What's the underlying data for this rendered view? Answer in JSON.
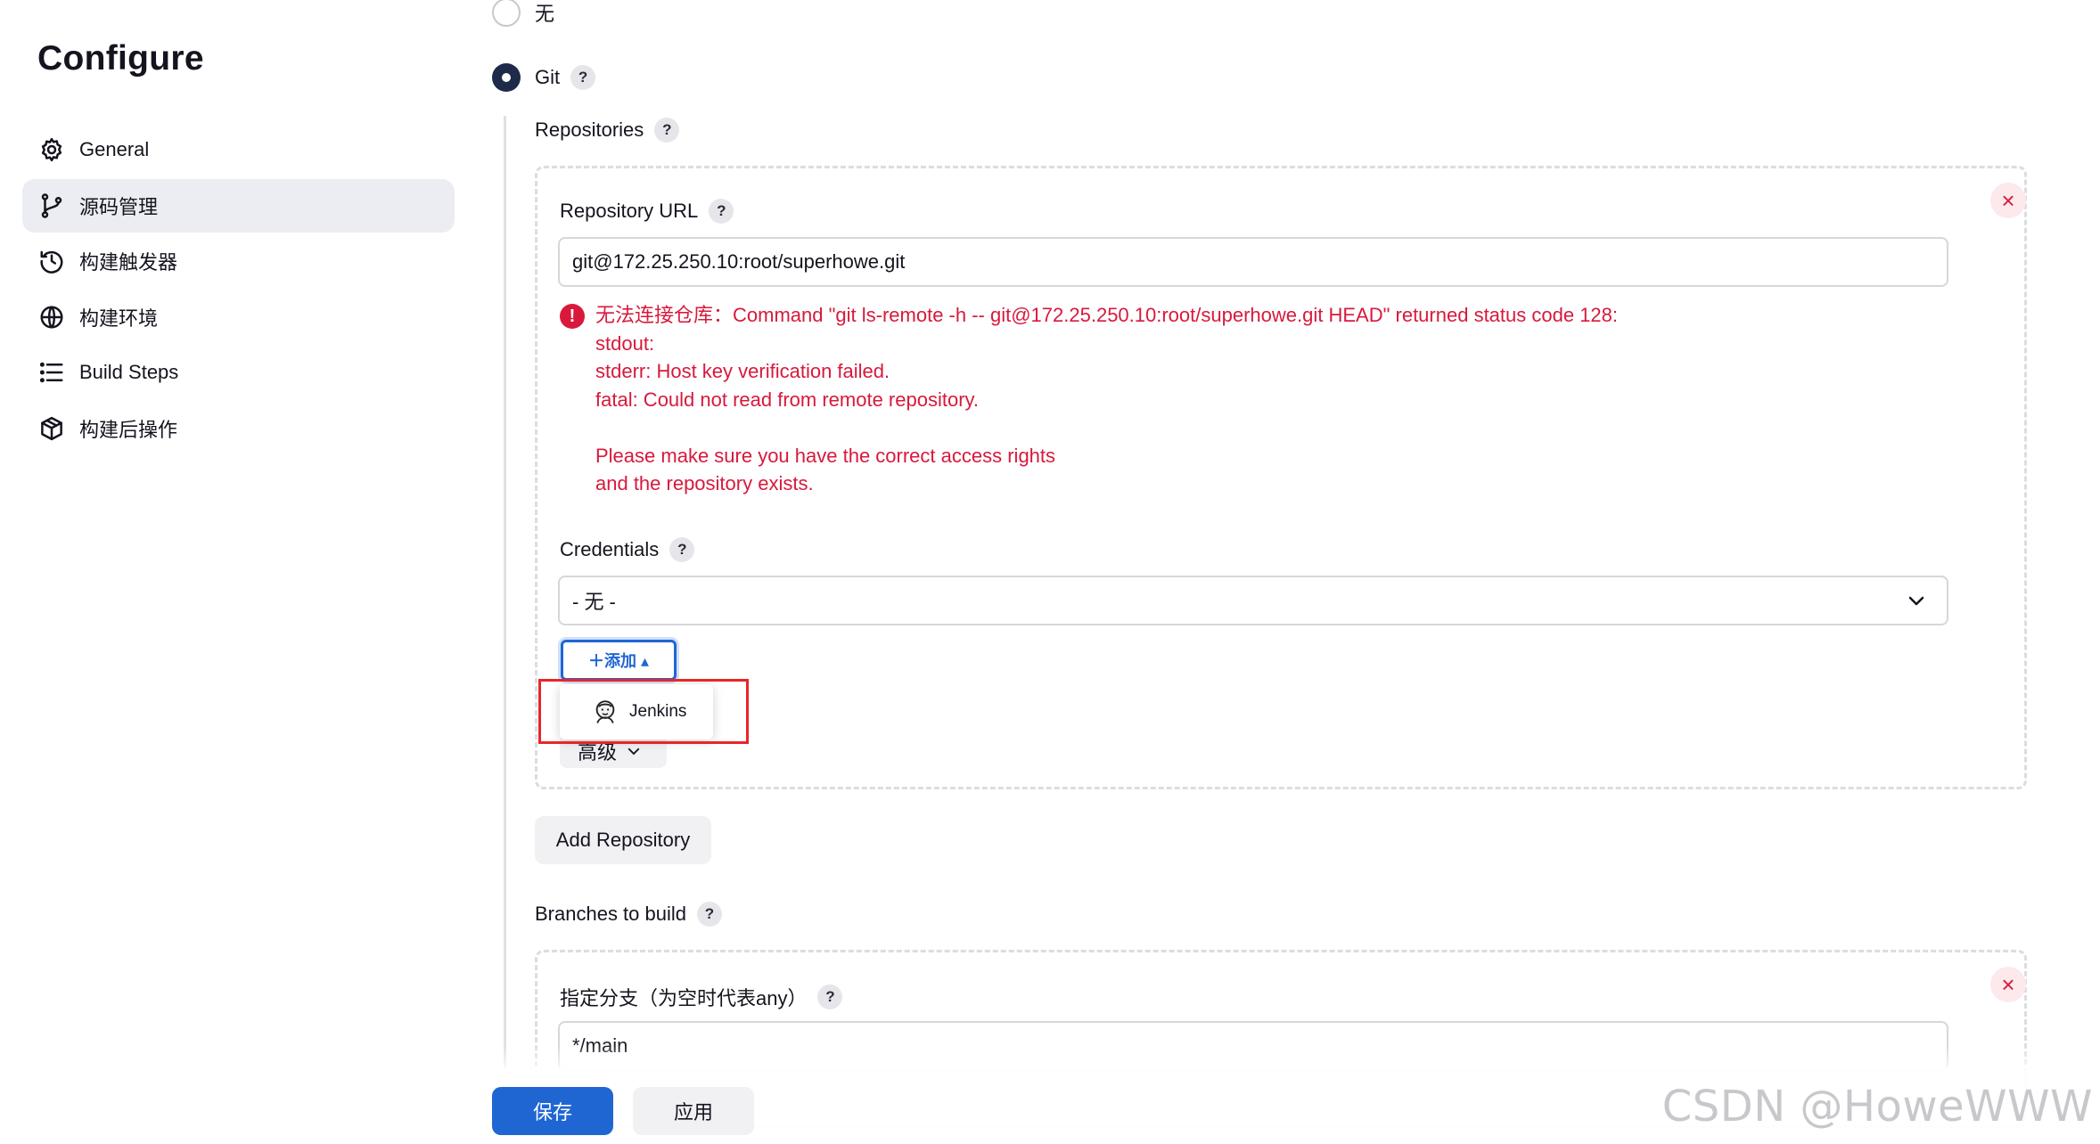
{
  "sidebar": {
    "title": "Configure",
    "items": [
      {
        "label": "General",
        "icon": "gear-icon",
        "active": false
      },
      {
        "label": "源码管理",
        "icon": "git-branch-icon",
        "active": true
      },
      {
        "label": "构建触发器",
        "icon": "clock-icon",
        "active": false
      },
      {
        "label": "构建环境",
        "icon": "globe-icon",
        "active": false
      },
      {
        "label": "Build Steps",
        "icon": "list-icon",
        "active": false
      },
      {
        "label": "构建后操作",
        "icon": "package-icon",
        "active": false
      }
    ]
  },
  "scm": {
    "option_none": "无",
    "option_git": "Git",
    "help": "?",
    "repositories_label": "Repositories",
    "repo": {
      "url_label": "Repository URL",
      "url_value": "git@172.25.250.10:root/superhowe.git",
      "error_lines": [
        "无法连接仓库：Command \"git ls-remote -h -- git@172.25.250.10:root/superhowe.git HEAD\" returned status code 128:",
        "stdout:",
        "stderr: Host key verification failed.",
        "fatal: Could not read from remote repository.",
        "",
        "Please make sure you have the correct access rights",
        "and the repository exists."
      ],
      "error_icon": "!",
      "credentials_label": "Credentials",
      "credentials_value": "- 无 -",
      "add_button": "＋添加 ▴",
      "dropdown_item": "Jenkins",
      "advanced_button": "高级"
    },
    "add_repository_button": "Add Repository",
    "branches_label": "Branches to build",
    "branch": {
      "specifier_label": "指定分支（为空时代表any）",
      "specifier_value": "*/main"
    },
    "close_symbol": "×"
  },
  "footer": {
    "save": "保存",
    "apply": "应用"
  },
  "watermark": "CSDN @HoweWWW",
  "colors": {
    "accent": "#1f66d3",
    "error": "#d8193c",
    "highlight": "#e8262a"
  }
}
